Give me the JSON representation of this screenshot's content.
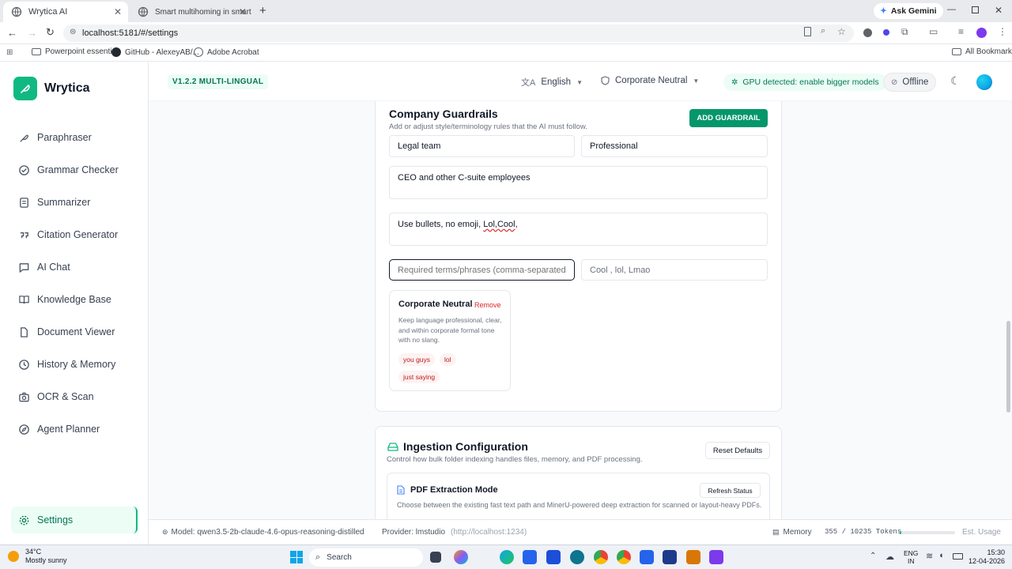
{
  "browser": {
    "tabs": [
      {
        "title": "Wrytica AI"
      },
      {
        "title": "Smart multihoming in smart sh"
      }
    ],
    "url": "localhost:5181/#/settings",
    "ask_gemini": "Ask Gemini",
    "bookmarks": [
      {
        "label": "Powerpoint essenti..."
      },
      {
        "label": "GitHub - AlexeyAB/..."
      },
      {
        "label": "Adobe Acrobat"
      }
    ],
    "all_bookmarks": "All Bookmarks"
  },
  "app": {
    "name": "Wrytica",
    "version_badge": "V1.2.2 MULTI-LINGUAL",
    "language": "English",
    "tone": "Corporate Neutral",
    "gpu_notice": "GPU detected: enable bigger models",
    "offline_label": "Offline",
    "accent_color": "#10b981"
  },
  "sidebar": {
    "items": [
      {
        "label": "Paraphraser",
        "icon": "feather-icon"
      },
      {
        "label": "Grammar Checker",
        "icon": "check-circle-icon"
      },
      {
        "label": "Summarizer",
        "icon": "document-icon"
      },
      {
        "label": "Citation Generator",
        "icon": "quote-icon"
      },
      {
        "label": "AI Chat",
        "icon": "chat-icon"
      },
      {
        "label": "Knowledge Base",
        "icon": "book-icon"
      },
      {
        "label": "Document Viewer",
        "icon": "file-icon"
      },
      {
        "label": "History & Memory",
        "icon": "history-icon"
      },
      {
        "label": "OCR & Scan",
        "icon": "camera-icon"
      },
      {
        "label": "Agent Planner",
        "icon": "compass-icon"
      }
    ],
    "settings_label": "Settings"
  },
  "guardrails": {
    "title": "Company Guardrails",
    "subtitle": "Add or adjust style/terminology rules that the AI must follow.",
    "add_button": "ADD GUARDRAIL",
    "team_value": "Legal team",
    "tone_value": "Professional",
    "audience_value": "CEO and other C-suite employees",
    "rules_value_plain": "Use bullets, no emoji, ",
    "rules_value_flagged": "Lol,Cool",
    "rules_value_tail": ",",
    "required_placeholder": "Required terms/phrases (comma-separated)",
    "banned_value": "Cool , lol, Lmao",
    "existing": {
      "name": "Corporate Neutral",
      "remove_label": "Remove",
      "description": "Keep language professional, clear, and within corporate formal tone with no slang.",
      "chips": [
        "you guys",
        "lol",
        "just saying"
      ]
    }
  },
  "ingestion": {
    "title": "Ingestion Configuration",
    "subtitle": "Control how bulk folder indexing handles files, memory, and PDF processing.",
    "reset_button": "Reset Defaults",
    "pdf_title": "PDF Extraction Mode",
    "refresh_button": "Refresh Status",
    "pdf_desc": "Choose between the existing fast text path and MinerU-powered deep extraction for scanned or layout-heavy PDFs."
  },
  "status": {
    "model": "Model: qwen3.5-2b-claude-4.6-opus-reasoning-distilled",
    "provider": "Provider: lmstudio",
    "endpoint": "(http://localhost:1234)",
    "memory_label": "Memory",
    "tokens": "355 / 10235 Tokens",
    "token_fraction": 0.035,
    "usage_label": "Est. Usage"
  },
  "taskbar": {
    "temperature": "34°C",
    "weather": "Mostly sunny",
    "search_placeholder": "Search",
    "lang_line1": "ENG",
    "lang_line2": "IN",
    "time": "15:30",
    "date": "12-04-2026"
  }
}
